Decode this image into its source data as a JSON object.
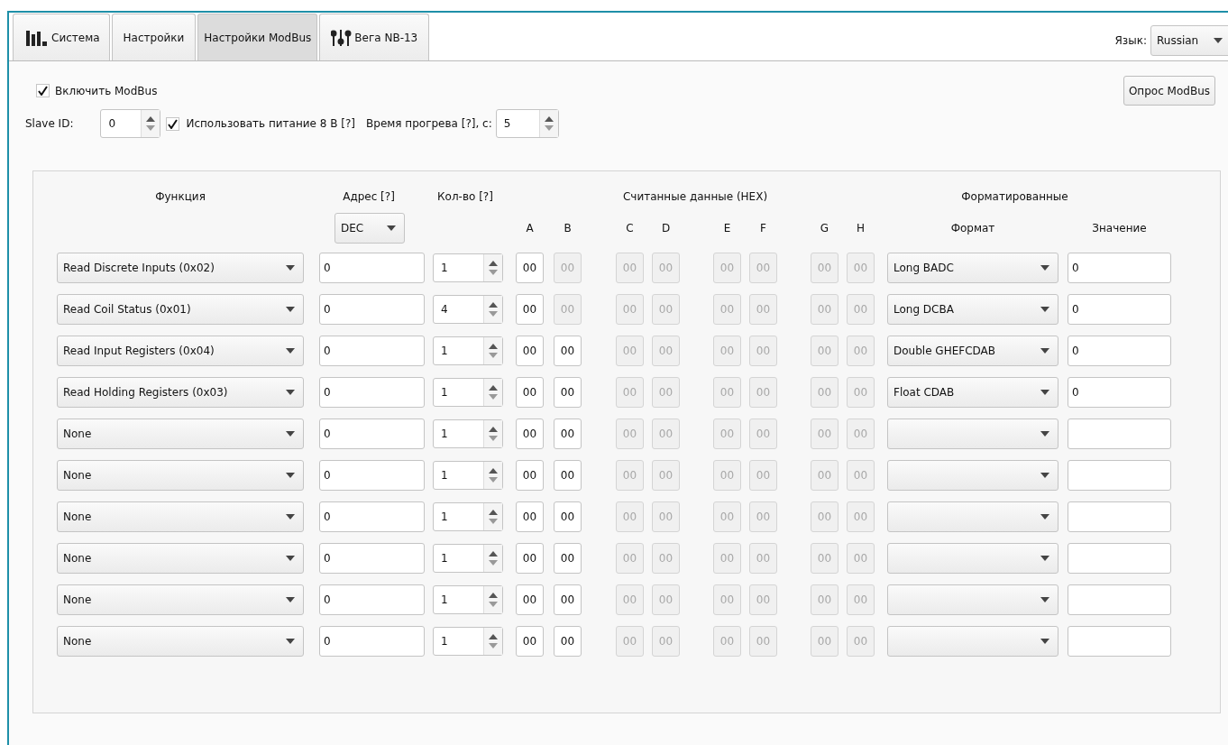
{
  "tabs": [
    {
      "label": "Система",
      "kind": "chart",
      "selected": false
    },
    {
      "label": "Настройки",
      "kind": "plain",
      "selected": false
    },
    {
      "label": "Настройки ModBus",
      "kind": "plain",
      "selected": true
    },
    {
      "label": "Вега NB-13",
      "kind": "sliders",
      "selected": false
    }
  ],
  "language": {
    "label": "Язык:",
    "value": "Russian"
  },
  "enable_modbus": {
    "label": "Включить ModBus",
    "checked": true
  },
  "poll_button": "Опрос ModBus",
  "slave_id": {
    "label": "Slave ID:",
    "value": "0"
  },
  "power_8v": {
    "label": "Использовать питание 8 В [?]",
    "checked": true
  },
  "warmup": {
    "label": "Время прогрева [?], с:",
    "value": "5"
  },
  "table": {
    "headers": {
      "function": "Функция",
      "address": "Адрес [?]",
      "count": "Кол-во [?]",
      "raw": "Считанные данные (HEX)",
      "formatted": "Форматированные",
      "format": "Формат",
      "value": "Значение"
    },
    "address_mode": "DEC",
    "byte_labels": [
      "A",
      "B",
      "C",
      "D",
      "E",
      "F",
      "G",
      "H"
    ],
    "rows": [
      {
        "function": "Read Discrete Inputs (0x02)",
        "address": "0",
        "count": "1",
        "bytes": [
          {
            "value": "00",
            "disabled": false
          },
          {
            "value": "00",
            "disabled": true
          },
          {
            "value": "00",
            "disabled": true
          },
          {
            "value": "00",
            "disabled": true
          },
          {
            "value": "00",
            "disabled": true
          },
          {
            "value": "00",
            "disabled": true
          },
          {
            "value": "00",
            "disabled": true
          },
          {
            "value": "00",
            "disabled": true
          }
        ],
        "format": "Long BADC",
        "value": "0"
      },
      {
        "function": "Read Coil Status (0x01)",
        "address": "0",
        "count": "4",
        "bytes": [
          {
            "value": "00",
            "disabled": false
          },
          {
            "value": "00",
            "disabled": true
          },
          {
            "value": "00",
            "disabled": true
          },
          {
            "value": "00",
            "disabled": true
          },
          {
            "value": "00",
            "disabled": true
          },
          {
            "value": "00",
            "disabled": true
          },
          {
            "value": "00",
            "disabled": true
          },
          {
            "value": "00",
            "disabled": true
          }
        ],
        "format": "Long DCBA",
        "value": "0"
      },
      {
        "function": "Read Input Registers (0x04)",
        "address": "0",
        "count": "1",
        "bytes": [
          {
            "value": "00",
            "disabled": false
          },
          {
            "value": "00",
            "disabled": false
          },
          {
            "value": "00",
            "disabled": true
          },
          {
            "value": "00",
            "disabled": true
          },
          {
            "value": "00",
            "disabled": true
          },
          {
            "value": "00",
            "disabled": true
          },
          {
            "value": "00",
            "disabled": true
          },
          {
            "value": "00",
            "disabled": true
          }
        ],
        "format": "Double GHEFCDAB",
        "value": "0"
      },
      {
        "function": "Read Holding Registers (0x03)",
        "address": "0",
        "count": "1",
        "bytes": [
          {
            "value": "00",
            "disabled": false
          },
          {
            "value": "00",
            "disabled": false
          },
          {
            "value": "00",
            "disabled": true
          },
          {
            "value": "00",
            "disabled": true
          },
          {
            "value": "00",
            "disabled": true
          },
          {
            "value": "00",
            "disabled": true
          },
          {
            "value": "00",
            "disabled": true
          },
          {
            "value": "00",
            "disabled": true
          }
        ],
        "format": "Float CDAB",
        "value": "0"
      },
      {
        "function": "None",
        "address": "0",
        "count": "1",
        "bytes": [
          {
            "value": "00",
            "disabled": false
          },
          {
            "value": "00",
            "disabled": false
          },
          {
            "value": "00",
            "disabled": true
          },
          {
            "value": "00",
            "disabled": true
          },
          {
            "value": "00",
            "disabled": true
          },
          {
            "value": "00",
            "disabled": true
          },
          {
            "value": "00",
            "disabled": true
          },
          {
            "value": "00",
            "disabled": true
          }
        ]
      },
      {
        "function": "None",
        "address": "0",
        "count": "1",
        "bytes": [
          {
            "value": "00",
            "disabled": false
          },
          {
            "value": "00",
            "disabled": false
          },
          {
            "value": "00",
            "disabled": true
          },
          {
            "value": "00",
            "disabled": true
          },
          {
            "value": "00",
            "disabled": true
          },
          {
            "value": "00",
            "disabled": true
          },
          {
            "value": "00",
            "disabled": true
          },
          {
            "value": "00",
            "disabled": true
          }
        ]
      },
      {
        "function": "None",
        "address": "0",
        "count": "1",
        "bytes": [
          {
            "value": "00",
            "disabled": false
          },
          {
            "value": "00",
            "disabled": false
          },
          {
            "value": "00",
            "disabled": true
          },
          {
            "value": "00",
            "disabled": true
          },
          {
            "value": "00",
            "disabled": true
          },
          {
            "value": "00",
            "disabled": true
          },
          {
            "value": "00",
            "disabled": true
          },
          {
            "value": "00",
            "disabled": true
          }
        ]
      },
      {
        "function": "None",
        "address": "0",
        "count": "1",
        "bytes": [
          {
            "value": "00",
            "disabled": false
          },
          {
            "value": "00",
            "disabled": false
          },
          {
            "value": "00",
            "disabled": true
          },
          {
            "value": "00",
            "disabled": true
          },
          {
            "value": "00",
            "disabled": true
          },
          {
            "value": "00",
            "disabled": true
          },
          {
            "value": "00",
            "disabled": true
          },
          {
            "value": "00",
            "disabled": true
          }
        ]
      },
      {
        "function": "None",
        "address": "0",
        "count": "1",
        "bytes": [
          {
            "value": "00",
            "disabled": false
          },
          {
            "value": "00",
            "disabled": false
          },
          {
            "value": "00",
            "disabled": true
          },
          {
            "value": "00",
            "disabled": true
          },
          {
            "value": "00",
            "disabled": true
          },
          {
            "value": "00",
            "disabled": true
          },
          {
            "value": "00",
            "disabled": true
          },
          {
            "value": "00",
            "disabled": true
          }
        ]
      },
      {
        "function": "None",
        "address": "0",
        "count": "1",
        "bytes": [
          {
            "value": "00",
            "disabled": false
          },
          {
            "value": "00",
            "disabled": false
          },
          {
            "value": "00",
            "disabled": true
          },
          {
            "value": "00",
            "disabled": true
          },
          {
            "value": "00",
            "disabled": true
          },
          {
            "value": "00",
            "disabled": true
          },
          {
            "value": "00",
            "disabled": true
          },
          {
            "value": "00",
            "disabled": true
          }
        ]
      }
    ]
  }
}
